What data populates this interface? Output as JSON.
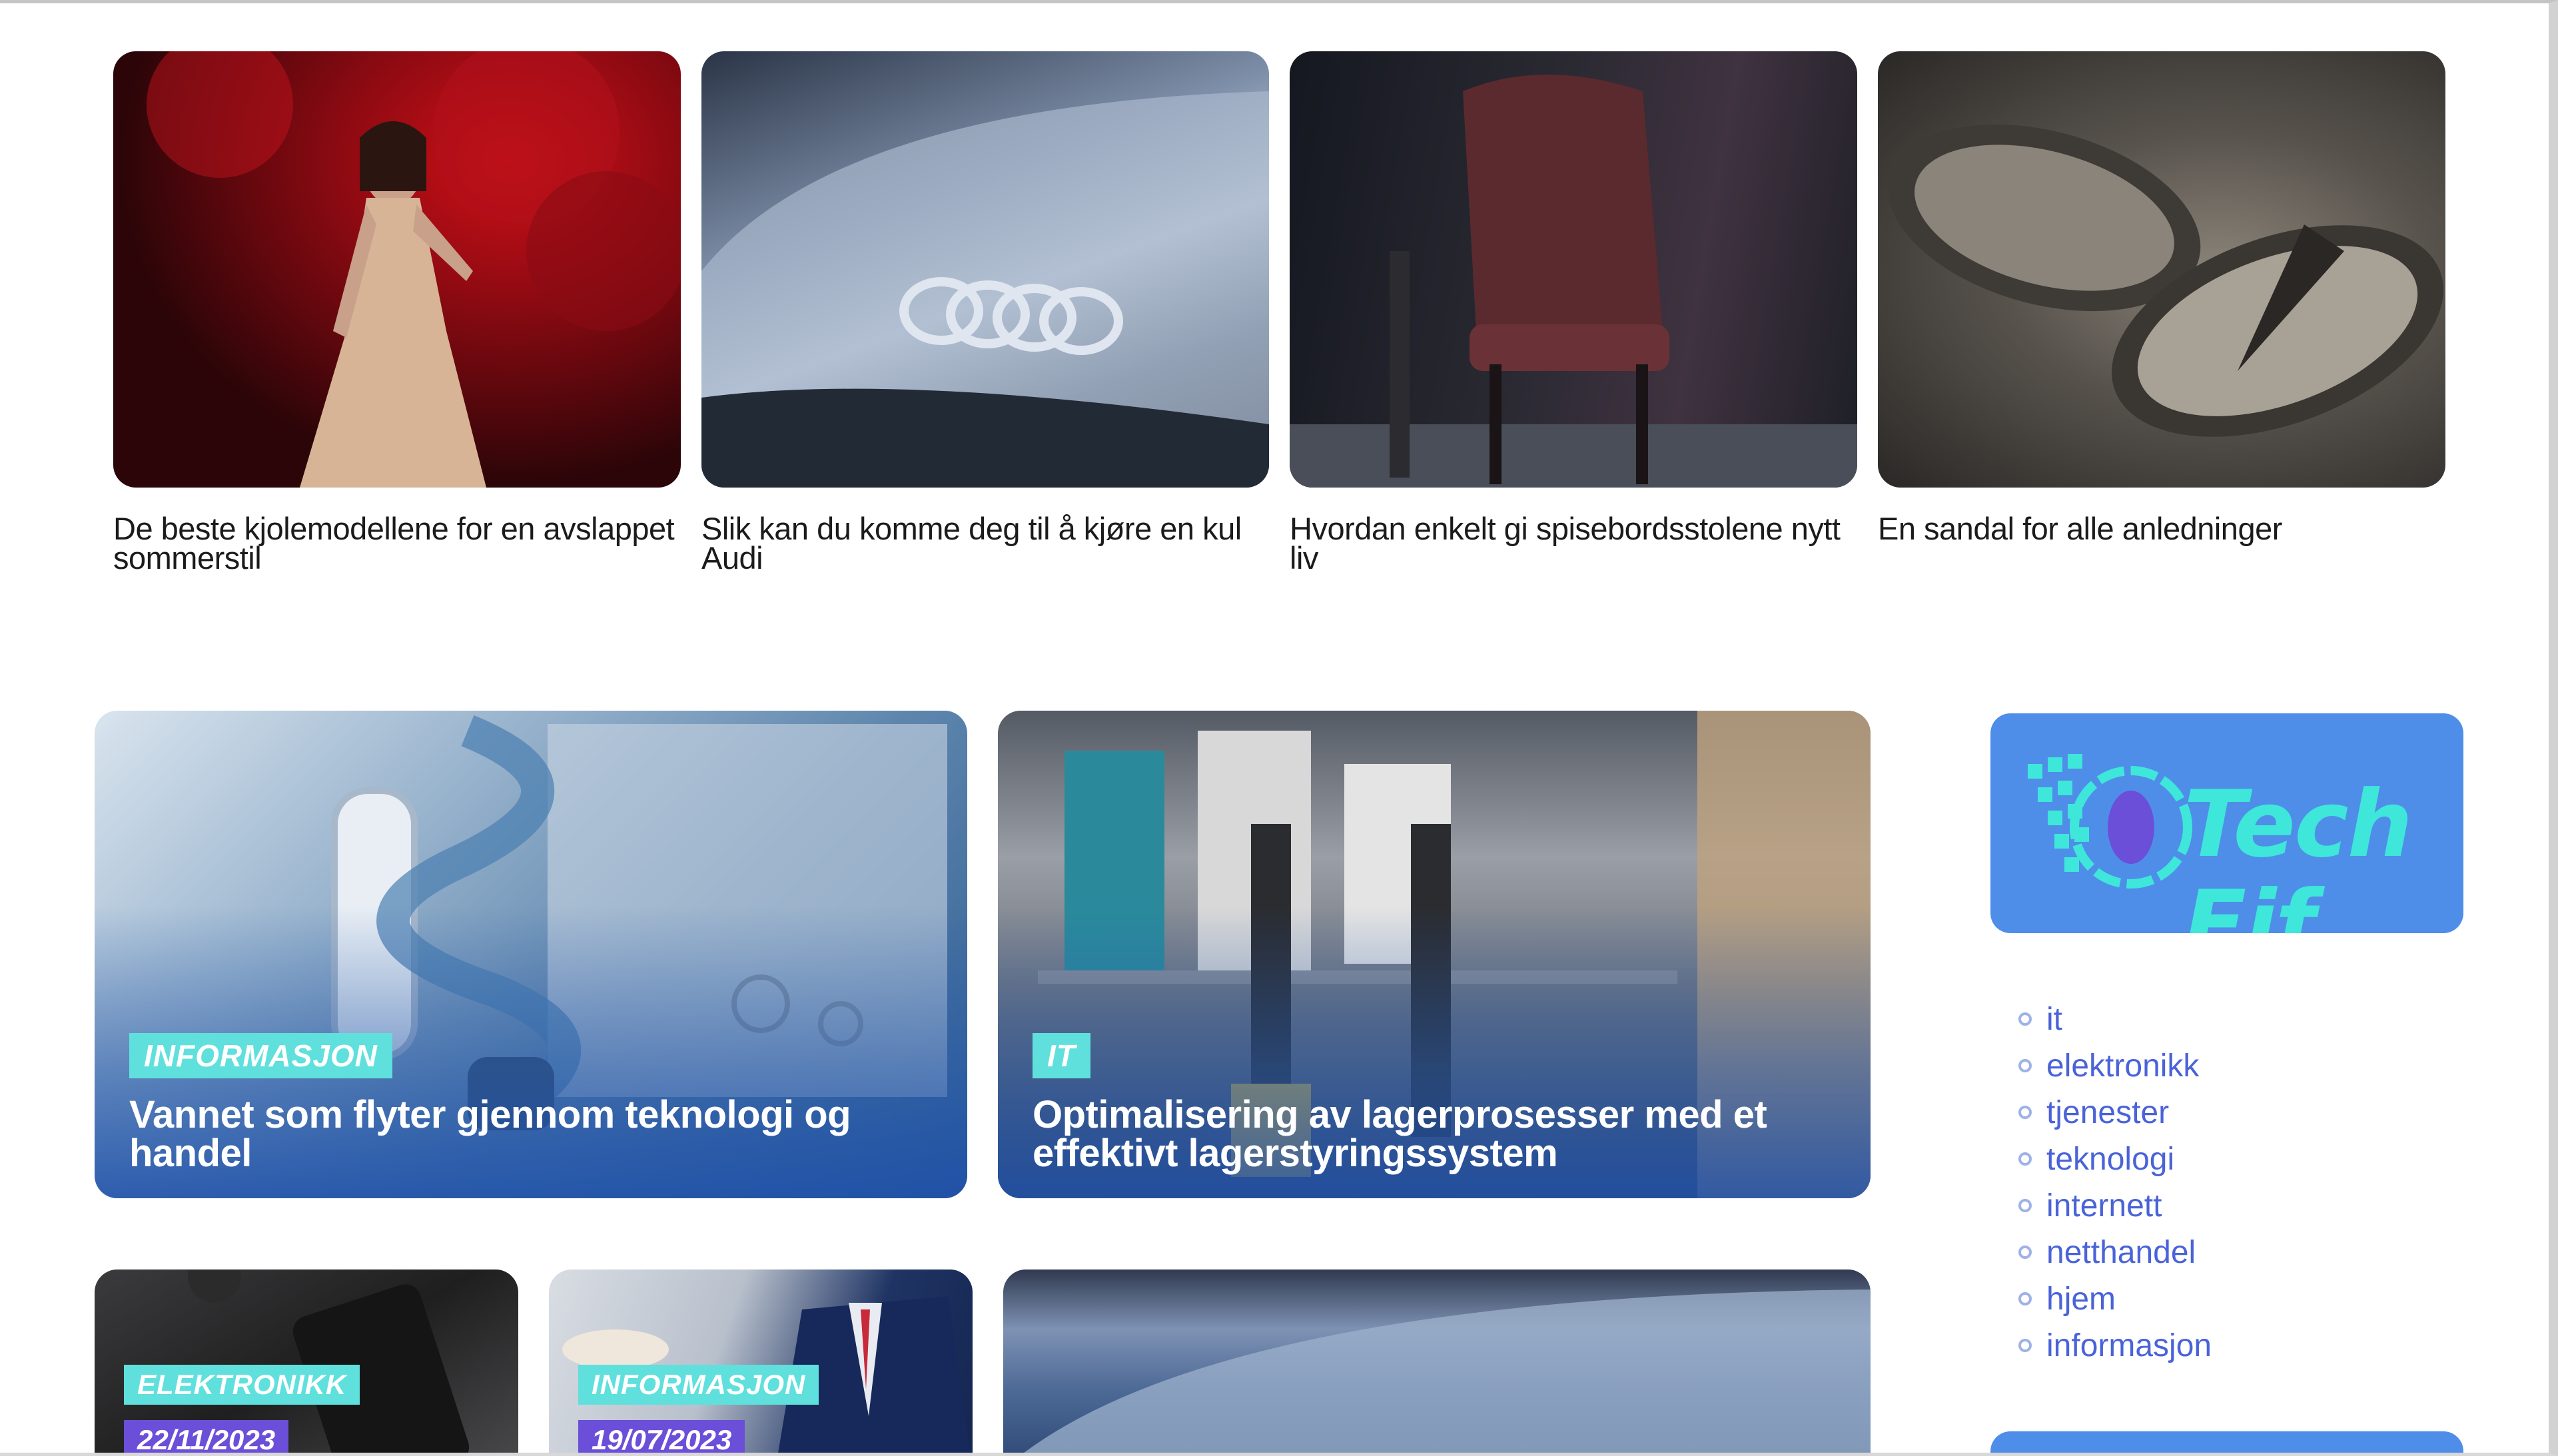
{
  "top_articles": [
    {
      "title": "De beste kjolemodellene for en avslappet sommerstil",
      "image": "woman-in-dress-red-foliage-photo"
    },
    {
      "title": "Slik kan du komme deg til å kjøre en kul Audi",
      "image": "audi-car-hood-photo"
    },
    {
      "title": "Hvordan enkelt gi spisebordsstolene nytt liv",
      "image": "leather-chair-photo"
    },
    {
      "title": "En sandal for alle anledninger",
      "image": "sandals-photo"
    }
  ],
  "featured": [
    {
      "tag": "INFORMASJON",
      "title": "Vannet som flyter gjennom teknologi og handel",
      "image": "water-technology-bathroom-illustration"
    },
    {
      "tag": "IT",
      "title": "Optimalisering av lagerprosesser med et effektivt lagerstyringssystem",
      "image": "warehouse-shelves-photo"
    }
  ],
  "bottom_articles": [
    {
      "tag": "ELEKTRONIKK",
      "date": "22/11/2023",
      "image": "phone-on-desk-photo"
    },
    {
      "tag": "INFORMASJON",
      "date": "19/07/2023",
      "image": "businessman-photo"
    },
    {
      "image": "car-hood-water-drops-photo"
    }
  ],
  "sidebar": {
    "logo_text": "Tech Fif",
    "categories": [
      "it",
      "elektronikk",
      "tjenester",
      "teknologi",
      "internett",
      "netthandel",
      "hjem",
      "informasjon"
    ]
  },
  "colors": {
    "tag_bg": "#5fe0dd",
    "date_bg": "#6b4fd8",
    "logo_bg": "#4f8ee8",
    "logo_text": "#3ee7d9",
    "link": "#4a63d8"
  }
}
